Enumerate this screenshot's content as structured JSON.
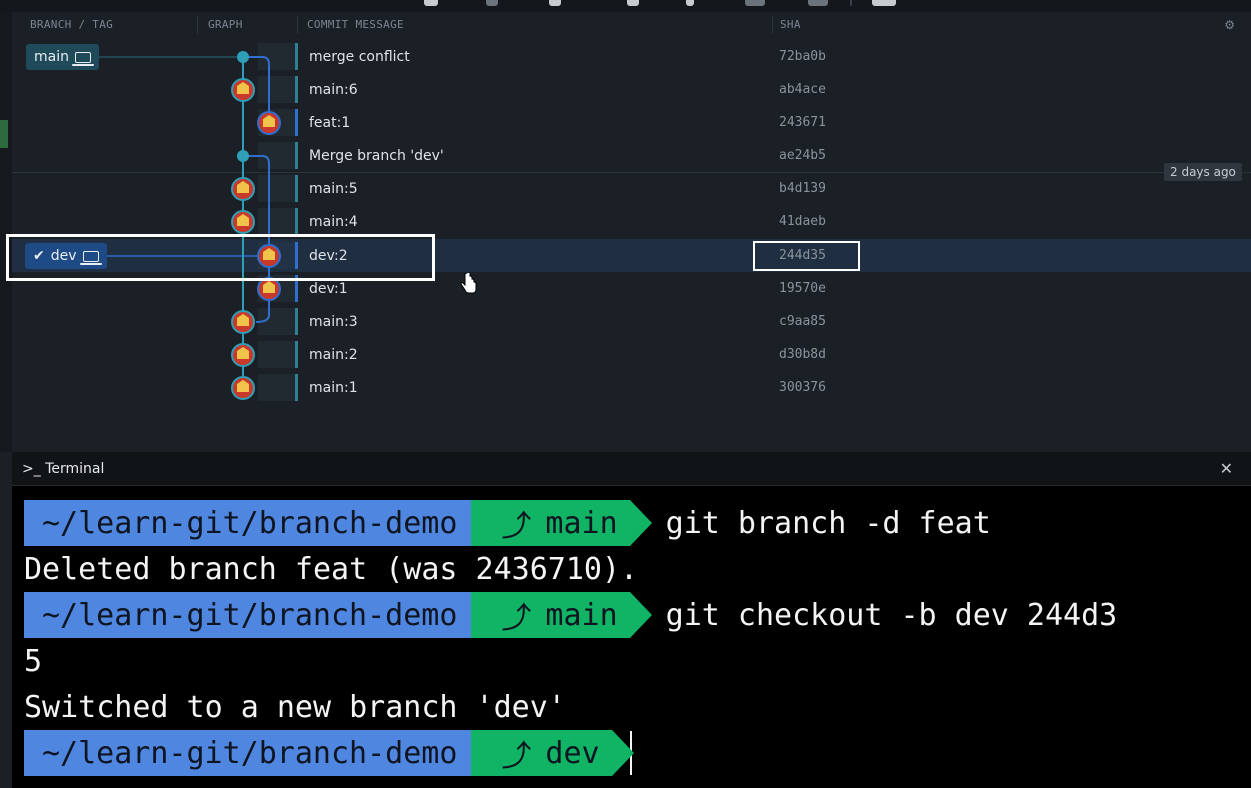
{
  "graph_header": {
    "col_branch": "BRANCH / TAG",
    "col_graph": "GRAPH",
    "col_message": "COMMIT MESSAGE",
    "col_sha": "SHA"
  },
  "branches": {
    "main": "main",
    "dev": "dev"
  },
  "commits": [
    {
      "message": "merge conflict",
      "sha": "72ba0b"
    },
    {
      "message": "main:6",
      "sha": "ab4ace"
    },
    {
      "message": "feat:1",
      "sha": "243671"
    },
    {
      "message": "Merge branch 'dev'",
      "sha": "ae24b5"
    },
    {
      "message": "main:5",
      "sha": "b4d139"
    },
    {
      "message": "main:4",
      "sha": "41daeb"
    },
    {
      "message": "dev:2",
      "sha": "244d35"
    },
    {
      "message": "dev:1",
      "sha": "19570e"
    },
    {
      "message": "main:3",
      "sha": "c9aa85"
    },
    {
      "message": "main:2",
      "sha": "d30b8d"
    },
    {
      "message": "main:1",
      "sha": "300376"
    }
  ],
  "time_badge": "2 days ago",
  "terminal": {
    "title": "Terminal",
    "prompt_path": "~/learn-git/branch-demo",
    "lines": [
      {
        "kind": "prompt",
        "branch": "main",
        "command": "git branch -d feat"
      },
      {
        "kind": "output",
        "text": "Deleted branch feat (was 2436710)."
      },
      {
        "kind": "prompt",
        "branch": "main",
        "command": "git checkout -b dev 244d3"
      },
      {
        "kind": "output",
        "text": "5"
      },
      {
        "kind": "output",
        "text": "Switched to a new branch 'dev'"
      },
      {
        "kind": "prompt",
        "branch": "dev",
        "command": ""
      }
    ]
  },
  "colors": {
    "main_lane": "#2f9fb8",
    "dev_lane": "#2f6fd0",
    "prompt_path_bg": "#4f86e0",
    "prompt_branch_bg": "#11b464",
    "selected_row": "#1f2e40"
  }
}
